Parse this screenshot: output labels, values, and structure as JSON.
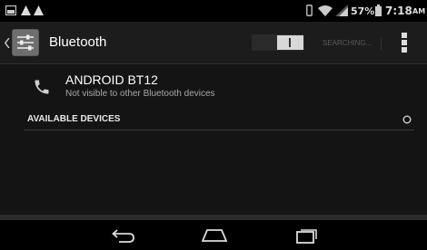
{
  "status_bar": {
    "battery_percent": "57%",
    "time": "7:18",
    "ampm": "AM",
    "icons": [
      "image-icon",
      "warning-icon",
      "warning-icon",
      "vibrate-icon",
      "wifi-icon",
      "signal-icon",
      "battery-icon"
    ]
  },
  "action_bar": {
    "title": "Bluetooth",
    "toggle_state": "on",
    "searching_label": "SEARCHING...",
    "icons": [
      "back-chevron-icon",
      "settings-sliders-icon",
      "overflow-menu-icon"
    ]
  },
  "device": {
    "name": "ANDROID BT12",
    "visibility": "Not visible to other Bluetooth devices",
    "icon": "phone-icon"
  },
  "available_devices": {
    "header": "AVAILABLE DEVICES",
    "icon": "spinner-icon"
  },
  "nav_bar": {
    "icons": [
      "back-icon",
      "home-icon",
      "recents-icon"
    ]
  },
  "colors": {
    "status_bar": "#000000",
    "action_bar": "#1c1c1c",
    "content": "#141414",
    "divider": "#3a3a3a",
    "accent_toggle": "#d8d8d8"
  }
}
